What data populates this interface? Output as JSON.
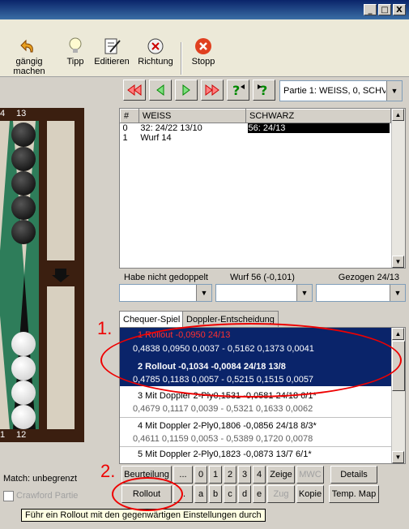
{
  "window": {
    "min": "_",
    "max": "□",
    "close": "X"
  },
  "toolbar": {
    "items": [
      {
        "label": "gängig machen"
      },
      {
        "label": "Tipp"
      },
      {
        "label": "Editieren"
      },
      {
        "label": "Richtung"
      },
      {
        "label": "Stopp"
      }
    ]
  },
  "game_select": {
    "value": "Partie 1: WEISS, 0, SCHV"
  },
  "board": {
    "label_top_left": "4",
    "label_top_right": "13",
    "label_bottom_left": "1",
    "label_bottom_right": "12"
  },
  "movelist": {
    "headers": [
      "#",
      "WEISS",
      "SCHWARZ"
    ],
    "rows": [
      {
        "num": "0",
        "white": "32: 24/22 13/10",
        "black": "56: 24/13"
      },
      {
        "num": "1",
        "white": "Wurf 14",
        "black": ""
      }
    ]
  },
  "status": {
    "left": "Habe nicht gedoppelt",
    "mid": "Wurf 56 (-0,101)",
    "right": "Gezogen 24/13"
  },
  "tabs": [
    {
      "label": "Chequer-Spiel"
    },
    {
      "label": "Doppler-Entscheidung"
    }
  ],
  "analysis": {
    "rows": [
      {
        "l1": "1   Rollout              -0,0950              24/13",
        "l2": "0,4838 0,0950 0,0037  -  0,5162 0,1373 0,0041",
        "selected": true,
        "red": true
      },
      {
        "l1": "2   Rollout              -0,1034   -0,0084  24/18 13/8",
        "l2": "0,4785 0,1183 0,0057  -  0,5215 0,1515 0,0057",
        "selected": true
      },
      {
        "l1": "3   Mit Doppler 2-Ply0,1531   -0,0581  24/18 6/1*",
        "l2": "0,4679 0,1117 0,0039  -  0,5321 0,1633 0,0062"
      },
      {
        "l1": "4   Mit Doppler 2-Ply0,1806   -0,0856  24/18 8/3*",
        "l2": "0,4611 0,1159 0,0053  -  0,5389 0,1720 0,0078"
      },
      {
        "l1": "5   Mit Doppler 2-Ply0,1823   -0,0873  13/7 6/1*",
        "l2": ""
      }
    ]
  },
  "match": {
    "label": "Match: unbegrenzt",
    "crawford": "Crawford Partie"
  },
  "buttons_row1": [
    "Beurteilung",
    "...",
    "0",
    "1",
    "2",
    "3",
    "4",
    "Zeige",
    "MWC",
    "Details"
  ],
  "buttons_row2": [
    "Rollout",
    "..",
    "a",
    "b",
    "c",
    "d",
    "e",
    "Zug",
    "Kopie",
    "Temp. Map"
  ],
  "tooltip": "Führ ein Rollout mit den gegenwärtigen Einstellungen durch",
  "annotations": {
    "a1": "1.",
    "a2": "2."
  },
  "colors": {
    "selection": "#0a246a",
    "highlight_red": "#e00000",
    "board_green": "#2e7d5a"
  }
}
